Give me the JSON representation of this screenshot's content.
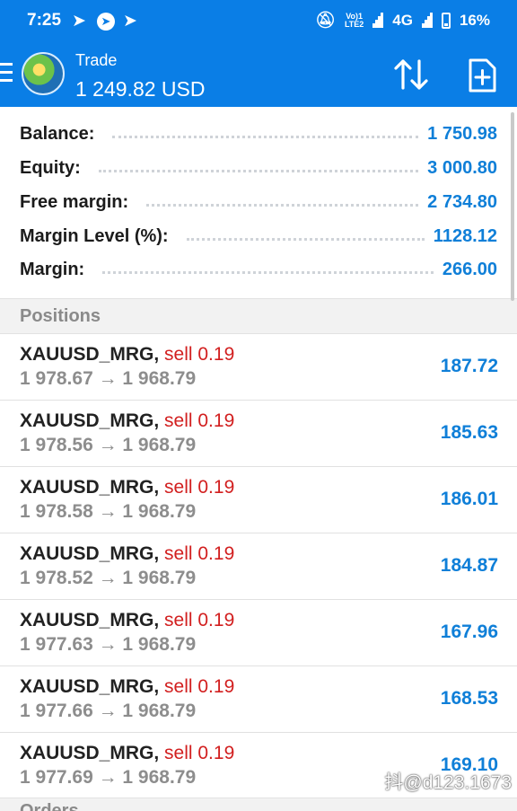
{
  "status_bar": {
    "time": "7:25",
    "network_label": "4G",
    "volte_label_top": "Vo)1",
    "volte_label_bottom": "LTE2",
    "battery": "16%",
    "icons": [
      "telegram-icon",
      "telegram-icon",
      "telegram-icon",
      "mute-icon",
      "signal-icon",
      "signal-icon",
      "battery-icon"
    ]
  },
  "header": {
    "title": "Trade",
    "value": "1 249.82 USD"
  },
  "summary": [
    {
      "label": "Balance:",
      "value": "1 750.98"
    },
    {
      "label": "Equity:",
      "value": "3 000.80"
    },
    {
      "label": "Free margin:",
      "value": "2 734.80"
    },
    {
      "label": "Margin Level (%):",
      "value": "1128.12"
    },
    {
      "label": "Margin:",
      "value": "266.00"
    }
  ],
  "positions_title": "Positions",
  "positions": [
    {
      "symbol": "XAUUSD_MRG,",
      "side": "sell 0.19",
      "prices": "1 978.67 → 1 968.79",
      "profit": "187.72"
    },
    {
      "symbol": "XAUUSD_MRG,",
      "side": "sell 0.19",
      "prices": "1 978.56 → 1 968.79",
      "profit": "185.63"
    },
    {
      "symbol": "XAUUSD_MRG,",
      "side": "sell 0.19",
      "prices": "1 978.58 → 1 968.79",
      "profit": "186.01"
    },
    {
      "symbol": "XAUUSD_MRG,",
      "side": "sell 0.19",
      "prices": "1 978.52 → 1 968.79",
      "profit": "184.87"
    },
    {
      "symbol": "XAUUSD_MRG,",
      "side": "sell 0.19",
      "prices": "1 977.63 → 1 968.79",
      "profit": "167.96"
    },
    {
      "symbol": "XAUUSD_MRG,",
      "side": "sell 0.19",
      "prices": "1 977.66 → 1 968.79",
      "profit": "168.53"
    },
    {
      "symbol": "XAUUSD_MRG,",
      "side": "sell 0.19",
      "prices": "1 977.69 → 1 968.79",
      "profit": "169.10"
    }
  ],
  "orders_title": "Orders",
  "watermark": "抖@d123.1673",
  "colors": {
    "accent": "#0a7ee6",
    "profit": "#0f7fd8",
    "sell": "#d21f1f"
  }
}
